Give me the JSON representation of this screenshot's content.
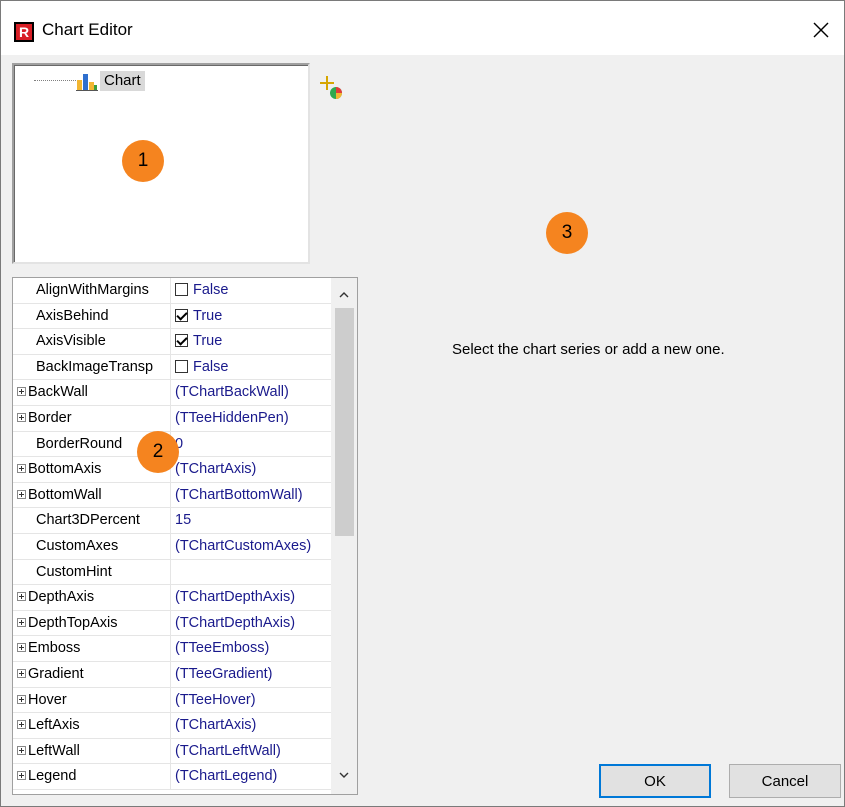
{
  "window": {
    "title": "Chart Editor",
    "app_icon_letter": "R",
    "accent_color": "#d81f26"
  },
  "tree": {
    "root_label": "Chart"
  },
  "badges": {
    "one": "1",
    "two": "2",
    "three": "3",
    "color": "#f5841f"
  },
  "properties": [
    {
      "name": "AlignWithMargins",
      "value": "False",
      "kind": "check",
      "checked": false,
      "expandable": false
    },
    {
      "name": "AxisBehind",
      "value": "True",
      "kind": "check",
      "checked": true,
      "expandable": false
    },
    {
      "name": "AxisVisible",
      "value": "True",
      "kind": "check",
      "checked": true,
      "expandable": false
    },
    {
      "name": "BackImageTransp",
      "value": "False",
      "kind": "check",
      "checked": false,
      "expandable": false
    },
    {
      "name": "BackWall",
      "value": "(TChartBackWall)",
      "kind": "text",
      "expandable": true
    },
    {
      "name": "Border",
      "value": "(TTeeHiddenPen)",
      "kind": "text",
      "expandable": true
    },
    {
      "name": "BorderRound",
      "value": "0",
      "kind": "text",
      "expandable": false
    },
    {
      "name": "BottomAxis",
      "value": "(TChartAxis)",
      "kind": "text",
      "expandable": true
    },
    {
      "name": "BottomWall",
      "value": "(TChartBottomWall)",
      "kind": "text",
      "expandable": true
    },
    {
      "name": "Chart3DPercent",
      "value": "15",
      "kind": "text",
      "expandable": false
    },
    {
      "name": "CustomAxes",
      "value": "(TChartCustomAxes)",
      "kind": "text",
      "expandable": false
    },
    {
      "name": "CustomHint",
      "value": "",
      "kind": "text",
      "expandable": false
    },
    {
      "name": "DepthAxis",
      "value": "(TChartDepthAxis)",
      "kind": "text",
      "expandable": true
    },
    {
      "name": "DepthTopAxis",
      "value": "(TChartDepthAxis)",
      "kind": "text",
      "expandable": true
    },
    {
      "name": "Emboss",
      "value": "(TTeeEmboss)",
      "kind": "text",
      "expandable": true
    },
    {
      "name": "Gradient",
      "value": "(TTeeGradient)",
      "kind": "text",
      "expandable": true
    },
    {
      "name": "Hover",
      "value": "(TTeeHover)",
      "kind": "text",
      "expandable": true
    },
    {
      "name": "LeftAxis",
      "value": "(TChartAxis)",
      "kind": "text",
      "expandable": true
    },
    {
      "name": "LeftWall",
      "value": "(TChartLeftWall)",
      "kind": "text",
      "expandable": true
    },
    {
      "name": "Legend",
      "value": "(TChartLegend)",
      "kind": "text",
      "expandable": true
    }
  ],
  "main": {
    "message": "Select the chart series or add a new one."
  },
  "buttons": {
    "ok": "OK",
    "cancel": "Cancel"
  }
}
